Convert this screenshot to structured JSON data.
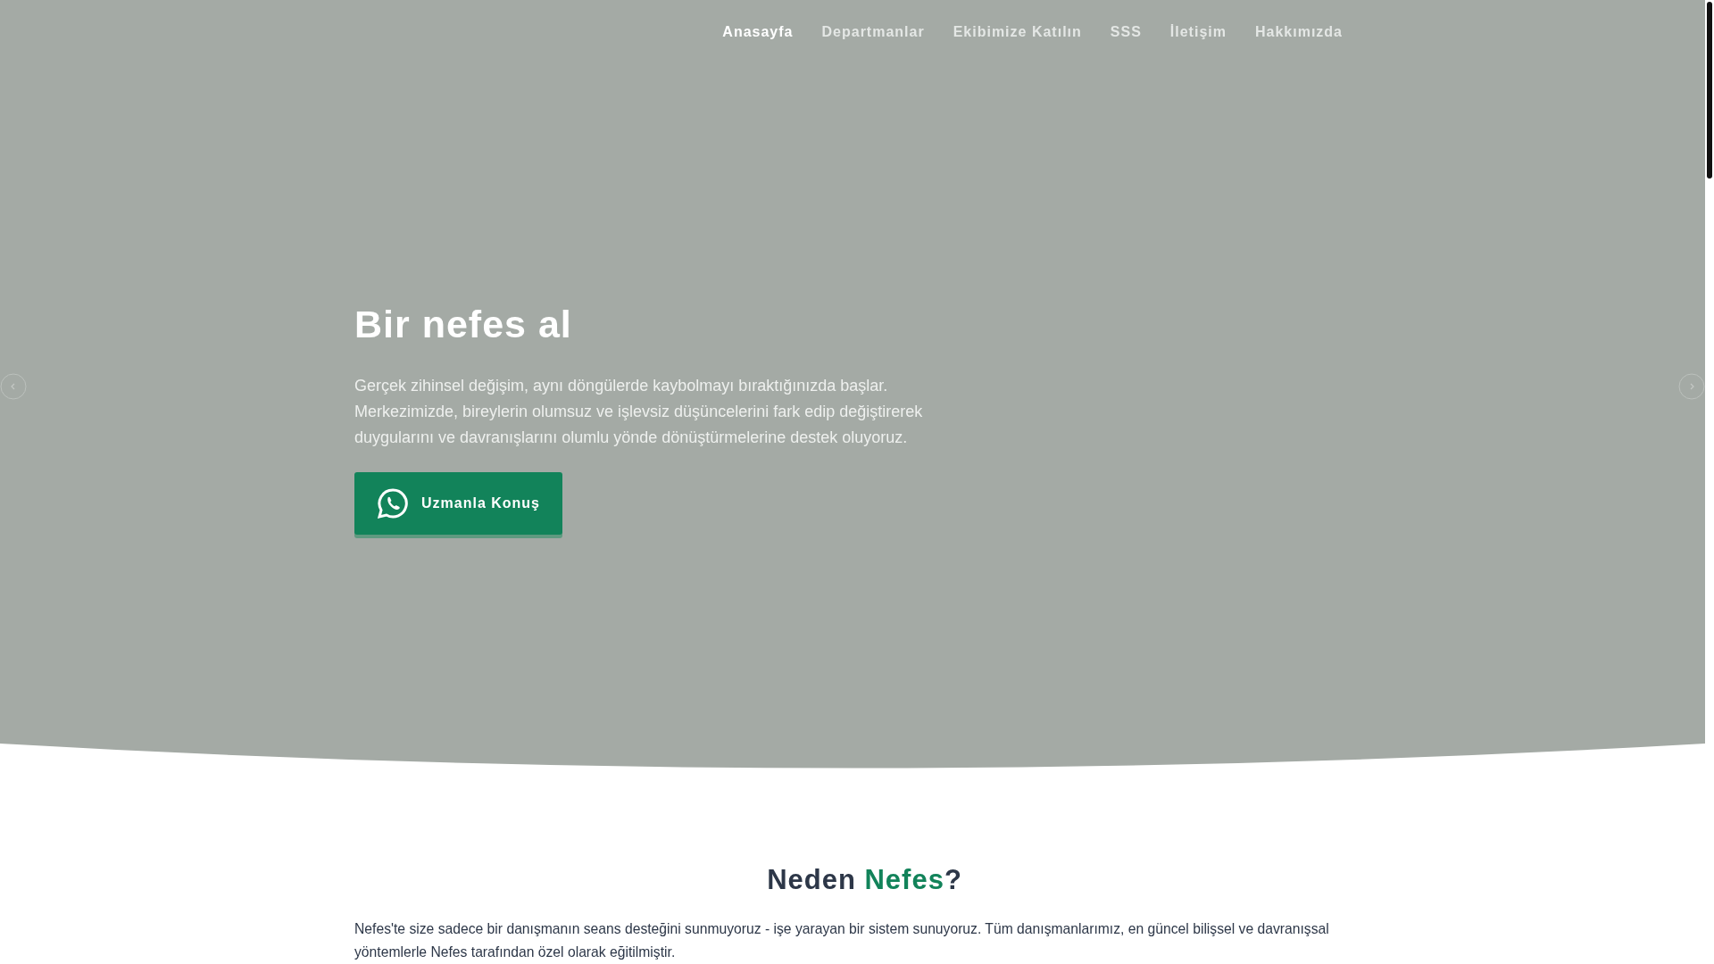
{
  "nav": {
    "items": [
      {
        "label": "Anasayfa",
        "selected": true
      },
      {
        "label": "Departmanlar",
        "selected": false
      },
      {
        "label": "Ekibimize Katılın",
        "selected": false
      },
      {
        "label": "SSS",
        "selected": false
      },
      {
        "label": "İletişim",
        "selected": false
      },
      {
        "label": "Hakkımızda",
        "selected": false
      }
    ]
  },
  "hero": {
    "title": "Bir nefes al",
    "text": "Gerçek zihinsel değişim, aynı döngülerde kaybolmayı bıraktığınızda başlar. Merkezimizde, bireylerin olumsuz ve işlevsiz düşüncelerini fark edip değiştirerek duygularını ve davranışlarını olumlu yönde dönüştürmelerine destek oluyoruz.",
    "button": "Uzmanla Konuş"
  },
  "why": {
    "title": "Neden *Nefes*?",
    "text": "Nefes'te size sadece bir danışmanın seans desteğini sunmuyoruz - işe yarayan bir sistem sunuyoruz. Tüm danışmanlarımız, en güncel bilişsel ve davranışsal yöntemlerle Nefes tarafından özel olarak eğitilmiştir."
  }
}
